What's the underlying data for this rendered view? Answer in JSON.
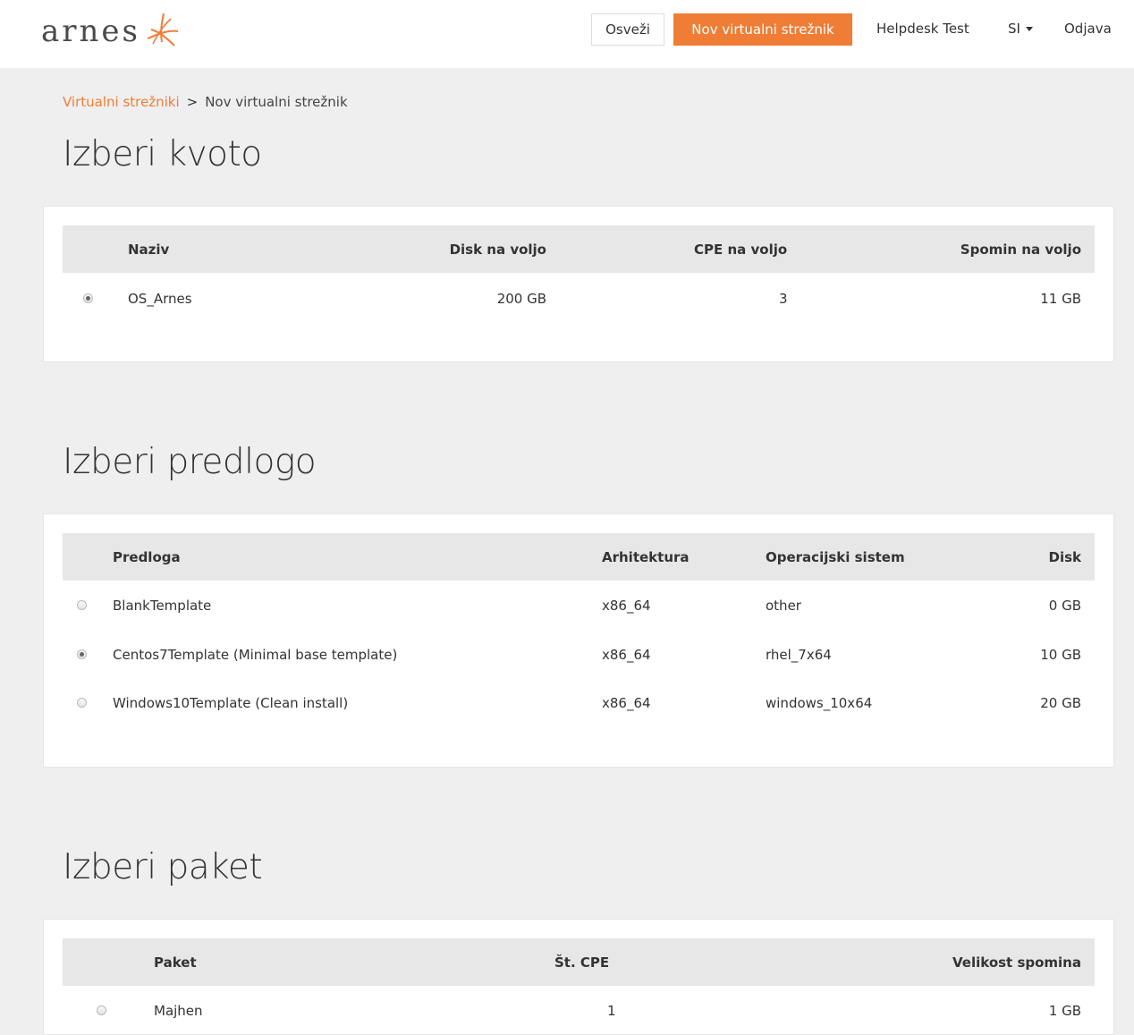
{
  "app": {
    "logo_text": "arnes"
  },
  "navbar": {
    "refresh_label": "Osveži",
    "new_server_label": "Nov virtualni strežnik",
    "user_label": "Helpdesk Test",
    "language_label": "SI",
    "logout_label": "Odjava"
  },
  "breadcrumb": {
    "parent": "Virtualni strežniki",
    "separator": ">",
    "current": "Nov virtualni strežnik"
  },
  "quota": {
    "title": "Izberi kvoto",
    "headers": [
      "Naziv",
      "Disk na voljo",
      "CPE na voljo",
      "Spomin na voljo"
    ],
    "rows": [
      {
        "selected": true,
        "name": "OS_Arnes",
        "disk": "200 GB",
        "cpu": "3",
        "memory": "11 GB"
      }
    ]
  },
  "template": {
    "title": "Izberi predlogo",
    "headers": [
      "Predloga",
      "Arhitektura",
      "Operacijski sistem",
      "Disk"
    ],
    "rows": [
      {
        "selected": false,
        "name": "BlankTemplate",
        "arch": "x86_64",
        "os": "other",
        "disk": "0 GB"
      },
      {
        "selected": true,
        "name": "Centos7Template (Minimal base template)",
        "arch": "x86_64",
        "os": "rhel_7x64",
        "disk": "10 GB"
      },
      {
        "selected": false,
        "name": "Windows10Template (Clean install)",
        "arch": "x86_64",
        "os": "windows_10x64",
        "disk": "20 GB"
      }
    ]
  },
  "package": {
    "title": "Izberi paket",
    "headers": [
      "Paket",
      "Št. CPE",
      "Velikost spomina"
    ],
    "rows": [
      {
        "selected": false,
        "name": "Majhen",
        "cpu": "1",
        "memory": "1 GB"
      }
    ]
  },
  "colors": {
    "accent": "#ef7d35",
    "background": "#efefef",
    "table_header": "#e7e7e7"
  }
}
